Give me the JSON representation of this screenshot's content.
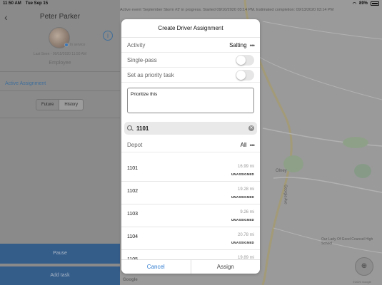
{
  "status_bar": {
    "time": "11:50 AM",
    "date": "Tue Sep 15",
    "battery": "89%"
  },
  "left_panel": {
    "driver_name": "Peter Parker",
    "service_status": "In service",
    "last_seen": "Last Seen - 09/15/2020 11:50 AM",
    "role": "Employee",
    "section_title": "Active Assignment",
    "tabs": [
      "Future",
      "History"
    ],
    "selected_tab": "History",
    "pause_label": "Pause",
    "add_task_label": "Add task"
  },
  "map": {
    "banner": "Active event 'September Storm #3' in progress. Started 09/10/2020 03:14 PM. Estimated completion: 09/13/2020 03:14 PM",
    "labels": {
      "town": "Olney",
      "road": "Georgia Ave",
      "church": "Our Lady Of Good Counsel High School"
    },
    "google": "Google",
    "copyright": "©2020 Google"
  },
  "modal": {
    "title": "Create Driver Assignment",
    "activity_label": "Activity",
    "activity_value": "Salting",
    "single_pass_label": "Single-pass",
    "priority_label": "Set as priority task",
    "notes": "Prioritize this",
    "search_value": "1101",
    "depot_label": "Depot",
    "depot_value": "All",
    "items": [
      {
        "name": "1101",
        "distance": "16.99 mi",
        "status": "UNASSIGNED"
      },
      {
        "name": "1102",
        "distance": "19.28 mi",
        "status": "UNASSIGNED"
      },
      {
        "name": "1103",
        "distance": "9.26 mi",
        "status": "UNASSIGNED"
      },
      {
        "name": "1104",
        "distance": "20.78 mi",
        "status": "UNASSIGNED"
      },
      {
        "name": "1105",
        "distance": "19.89 mi",
        "status": "UNASSIGNED"
      }
    ],
    "cancel_label": "Cancel",
    "assign_label": "Assign"
  }
}
